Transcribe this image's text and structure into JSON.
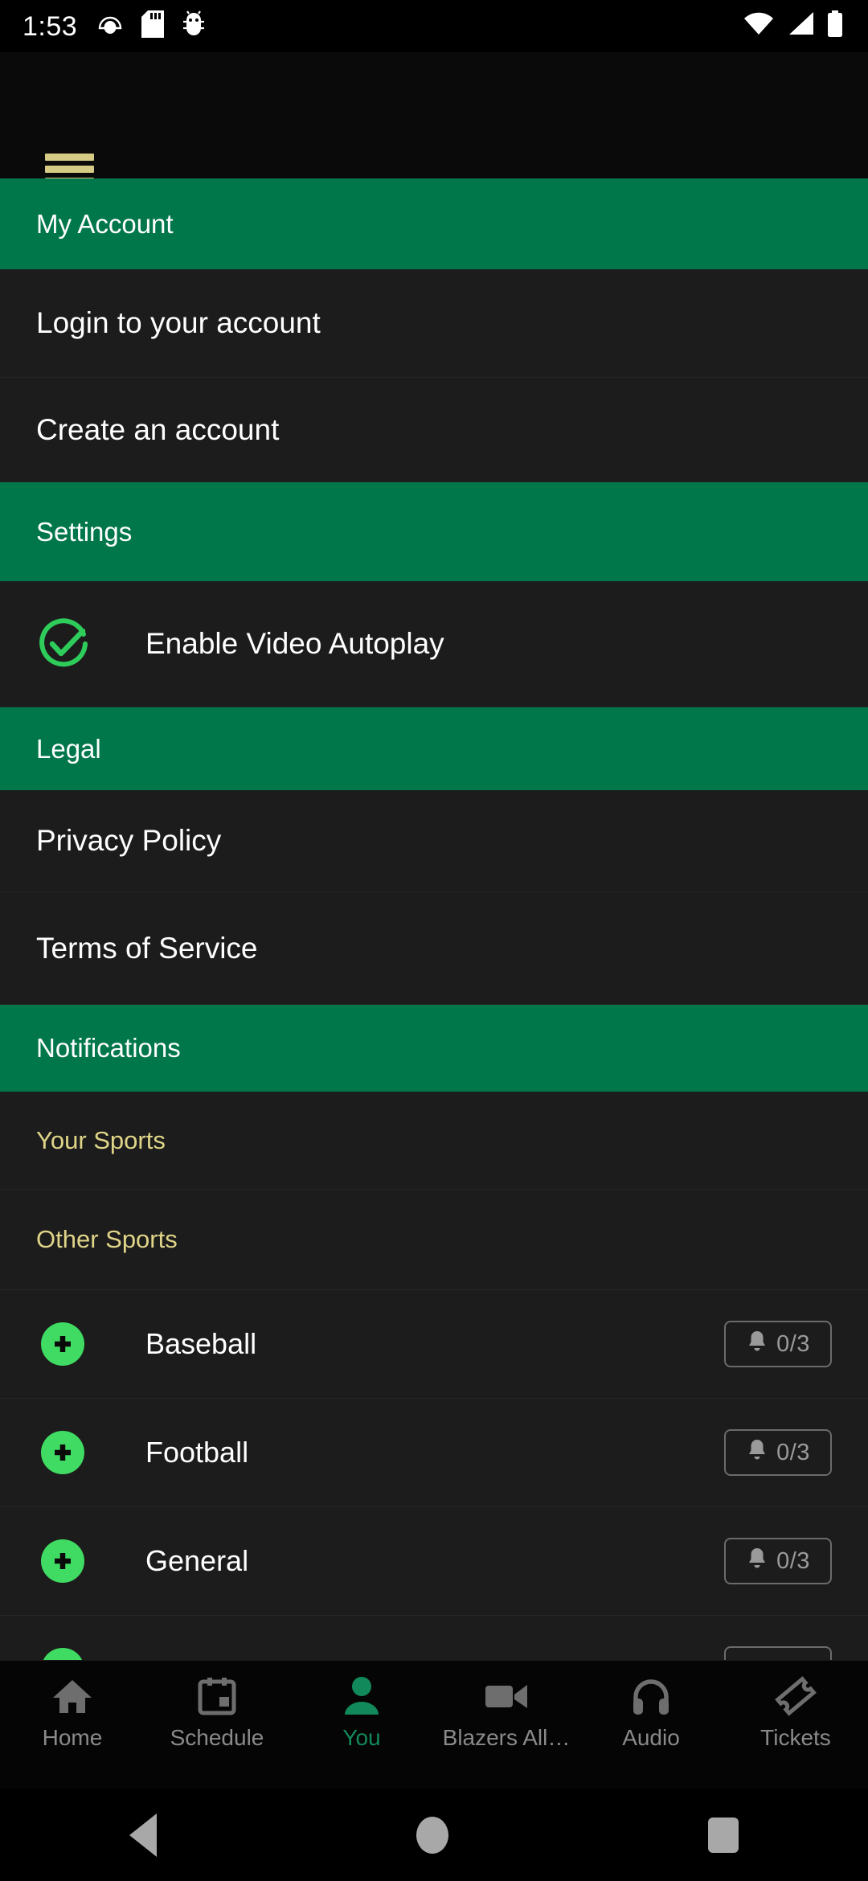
{
  "status_bar": {
    "time": "1:53",
    "left_icons": [
      "rose-bowl-game-logo-icon",
      "sd-card-icon",
      "android-debug-bug-icon"
    ],
    "right_icons": [
      "wifi-icon",
      "cell-signal-icon",
      "battery-icon"
    ]
  },
  "app_bar": {
    "menu_icon": "hamburger-menu-icon",
    "menu_color": "#D6CB84"
  },
  "colors": {
    "section_green": "#00774B",
    "accent_gold": "#DFD488",
    "row_background": "#1C1C1C",
    "check_green": "#2ECC5A",
    "plus_green": "#3FDB62",
    "active_tab_green": "#12895A"
  },
  "sections": {
    "my_account": {
      "title": "My Account",
      "items": [
        {
          "label": "Login to your account"
        },
        {
          "label": "Create an account"
        }
      ]
    },
    "settings": {
      "title": "Settings",
      "items": [
        {
          "label": "Enable Video Autoplay",
          "icon": "check-circle-icon",
          "checked": true
        }
      ]
    },
    "legal": {
      "title": "Legal",
      "items": [
        {
          "label": "Privacy Policy"
        },
        {
          "label": "Terms of Service"
        }
      ]
    },
    "notifications": {
      "title": "Notifications",
      "group_labels": [
        {
          "label": "Your Sports"
        },
        {
          "label": "Other Sports"
        }
      ],
      "sports": [
        {
          "label": "Baseball",
          "add_icon": "plus-circle-icon",
          "bell_icon": "bell-icon",
          "count": "0/3"
        },
        {
          "label": "Football",
          "add_icon": "plus-circle-icon",
          "bell_icon": "bell-icon",
          "count": "0/3"
        },
        {
          "label": "General",
          "add_icon": "plus-circle-icon",
          "bell_icon": "bell-icon",
          "count": "0/3"
        }
      ]
    }
  },
  "bottom_nav": {
    "tabs": [
      {
        "label": "Home",
        "icon": "home-icon",
        "active": false
      },
      {
        "label": "Schedule",
        "icon": "calendar-icon",
        "active": false
      },
      {
        "label": "You",
        "icon": "person-icon",
        "active": true
      },
      {
        "label": "Blazers All…",
        "icon": "video-camera-icon",
        "active": false
      },
      {
        "label": "Audio",
        "icon": "headphones-icon",
        "active": false
      },
      {
        "label": "Tickets",
        "icon": "ticket-icon",
        "active": false
      }
    ]
  },
  "android_nav": {
    "back": "back-triangle-icon",
    "home": "home-circle-icon",
    "recents": "recents-square-icon"
  }
}
